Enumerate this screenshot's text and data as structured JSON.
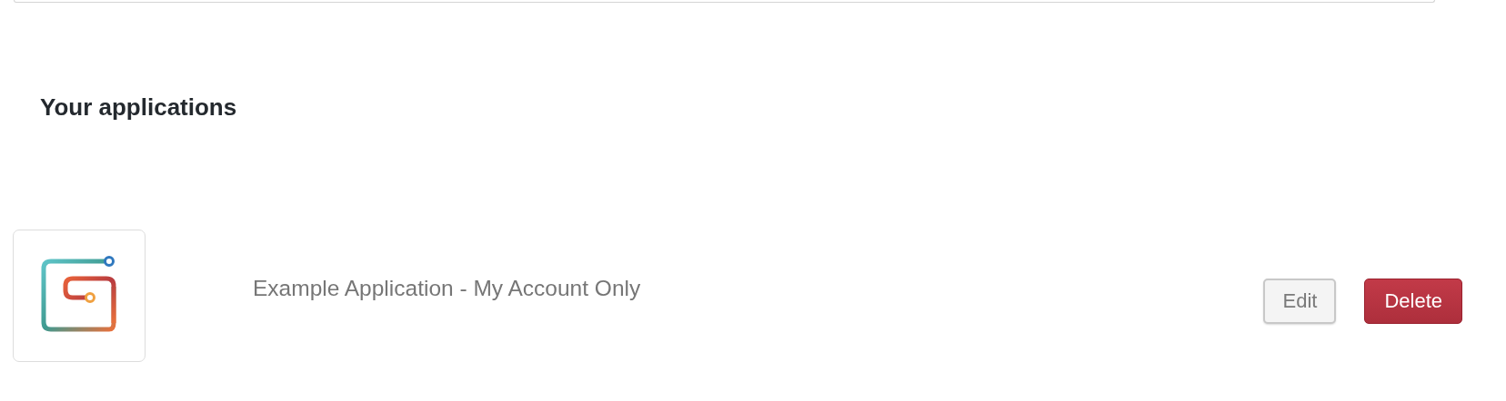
{
  "heading": "Your applications",
  "applications": [
    {
      "name": "Example Application - My Account Only",
      "buttons": [
        {
          "label": "Edit",
          "kind": "default"
        },
        {
          "label": "Delete",
          "kind": "danger"
        }
      ]
    }
  ]
}
